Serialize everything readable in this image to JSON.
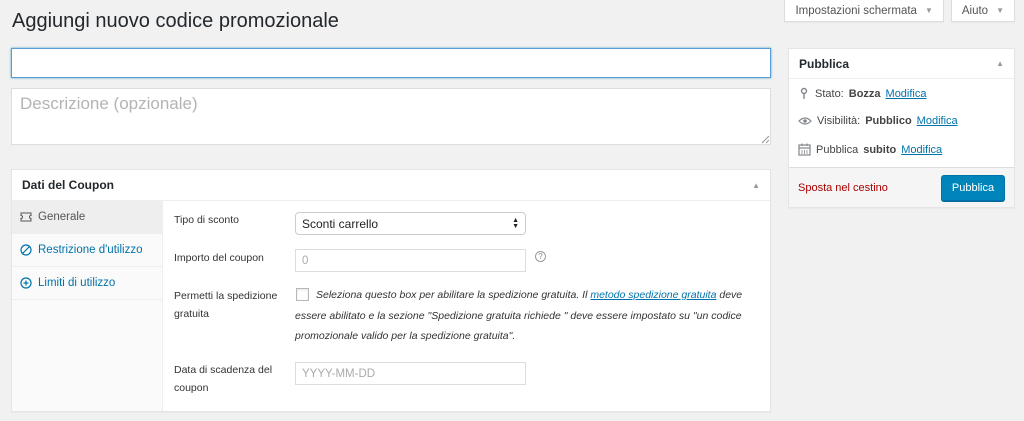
{
  "header": {
    "screen_options_label": "Impostazioni schermata",
    "help_label": "Aiuto",
    "page_title": "Aggiungi nuovo codice promozionale"
  },
  "editor": {
    "title_value": "",
    "description_placeholder": "Descrizione (opzionale)"
  },
  "coupon_data": {
    "title": "Dati del Coupon",
    "tabs": [
      {
        "label": "Generale",
        "icon": "ticket-icon",
        "active": true
      },
      {
        "label": "Restrizione d'utilizzo",
        "icon": "restriction-icon",
        "active": false
      },
      {
        "label": "Limiti di utilizzo",
        "icon": "plus-circle-icon",
        "active": false
      }
    ],
    "fields": {
      "discount_type": {
        "label": "Tipo di sconto",
        "value": "Sconti carrello"
      },
      "coupon_amount": {
        "label": "Importo del coupon",
        "placeholder": "0"
      },
      "free_shipping": {
        "label_line1": "Permetti la spedizione",
        "label_line2": "gratuita",
        "desc_before": "Seleziona questo box per abilitare la spedizione gratuita. Il ",
        "link_text": "metodo spedizione gratuita",
        "desc_after": " deve essere abilitato e la sezione \"Spedizione gratuita richiede \" deve essere impostato su \"un codice promozionale valido per la spedizione gratuita\"."
      },
      "expiry_date": {
        "label_line1": "Data di scadenza del",
        "label_line2": "coupon",
        "placeholder": "YYYY-MM-DD"
      }
    }
  },
  "publish": {
    "title": "Pubblica",
    "status_label": "Stato:",
    "status_value": "Bozza",
    "visibility_label": "Visibilità:",
    "visibility_value": "Pubblico",
    "schedule_label": "Pubblica",
    "schedule_value": "subito",
    "edit_link": "Modifica",
    "trash_label": "Sposta nel cestino",
    "publish_button": "Pubblica"
  },
  "colors": {
    "accent": "#0073aa",
    "primary_button": "#0085ba",
    "trash": "#aa0000"
  }
}
